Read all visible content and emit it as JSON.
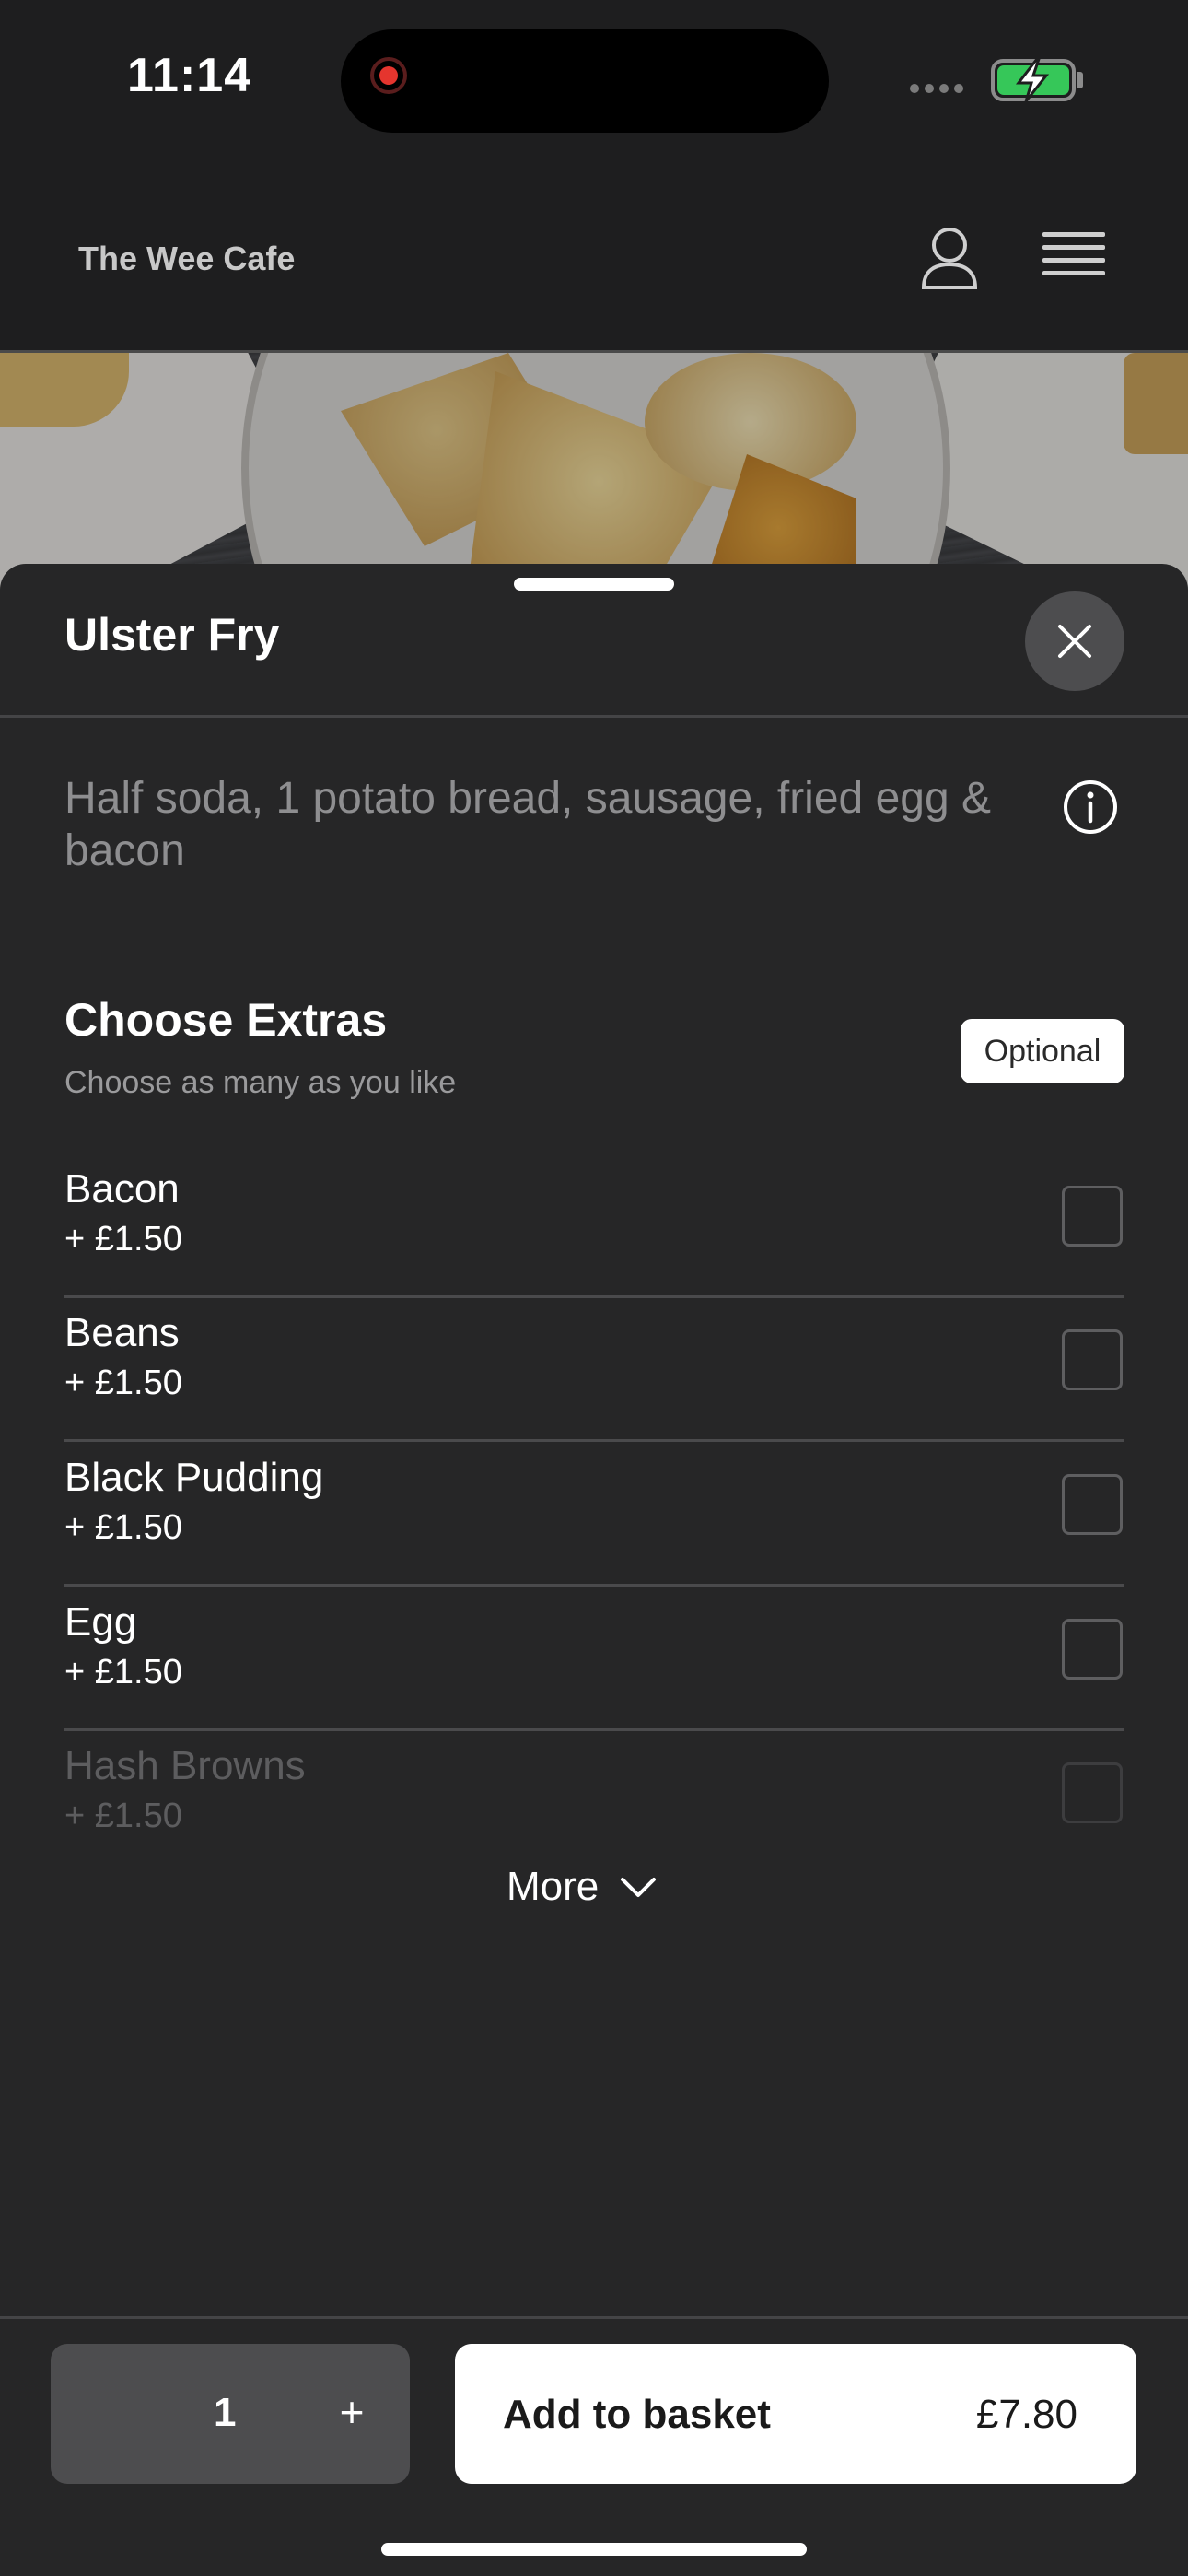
{
  "status_bar": {
    "time": "11:14"
  },
  "header": {
    "cafe_name": "The Wee Cafe"
  },
  "item": {
    "title": "Ulster Fry",
    "description": "Half soda, 1 potato bread, sausage, fried egg & bacon"
  },
  "extras": {
    "title": "Choose Extras",
    "subtitle": "Choose as many as you like",
    "badge": "Optional",
    "options": [
      {
        "name": "Bacon",
        "price": "+ £1.50",
        "checked": false
      },
      {
        "name": "Beans",
        "price": "+ £1.50",
        "checked": false
      },
      {
        "name": "Black Pudding",
        "price": "+ £1.50",
        "checked": false
      },
      {
        "name": "Egg",
        "price": "+ £1.50",
        "checked": false
      },
      {
        "name": "Hash Browns",
        "price": "+ £1.50",
        "checked": false
      }
    ],
    "more_label": "More"
  },
  "footer": {
    "quantity": "1",
    "plus_label": "+",
    "add_label": "Add to basket",
    "add_price": "£7.80"
  },
  "colors": {
    "background": "#1e1e1f",
    "sheet": "#262627",
    "battery": "#36c759",
    "recording": "#e5352e"
  }
}
